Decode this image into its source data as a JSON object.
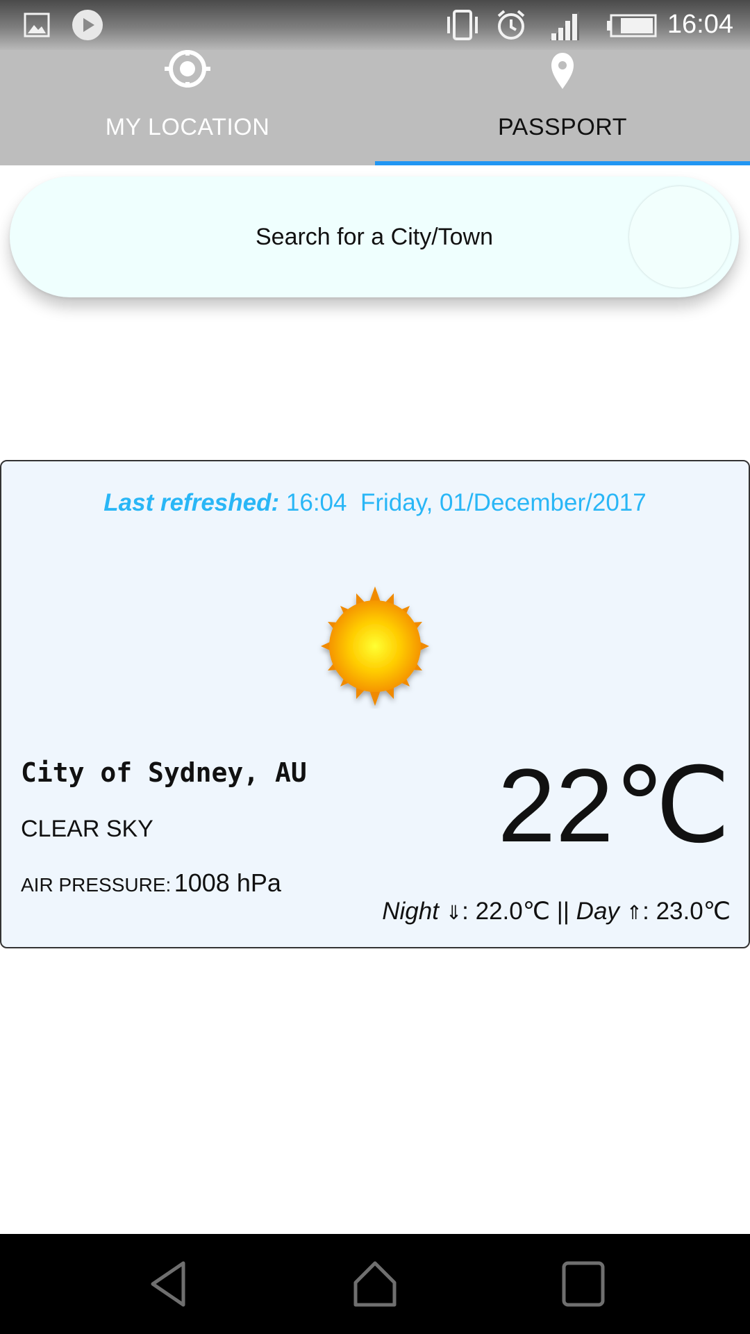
{
  "status_bar": {
    "time": "16:04",
    "icons": [
      "gallery-icon",
      "play-icon",
      "vibrate-icon",
      "alarm-icon",
      "signal-icon",
      "battery-icon"
    ]
  },
  "tabs": [
    {
      "label": "MY LOCATION",
      "icon": "crosshair-icon",
      "selected": false
    },
    {
      "label": "PASSPORT",
      "icon": "map-pin-icon",
      "selected": true
    }
  ],
  "search": {
    "placeholder": "Search for a City/Town"
  },
  "weather": {
    "last_refreshed_label": "Last refreshed:",
    "last_refreshed_time": "16:04",
    "date": "Friday, 01/December/2017",
    "icon": "sun-icon",
    "city": "City of Sydney, AU",
    "condition": "CLEAR SKY",
    "pressure_label": "AIR PRESSURE:",
    "pressure_value": "1008 hPa",
    "temperature": "22℃",
    "night_label": "Night",
    "night_arrow": "⇓",
    "night_value": ": 22.0℃",
    "separator": " || ",
    "day_label": "Day",
    "day_arrow": "⇑",
    "day_value": ": 23.0℃"
  },
  "nav_bar": {
    "buttons": [
      "back-icon",
      "home-icon",
      "recents-icon"
    ]
  },
  "colors": {
    "accent": "#2196f3",
    "refreshed_text": "#29b6f6",
    "card_background": "#eff6fd",
    "search_background": "#effffe",
    "tab_bar": "#bdbdbd"
  }
}
